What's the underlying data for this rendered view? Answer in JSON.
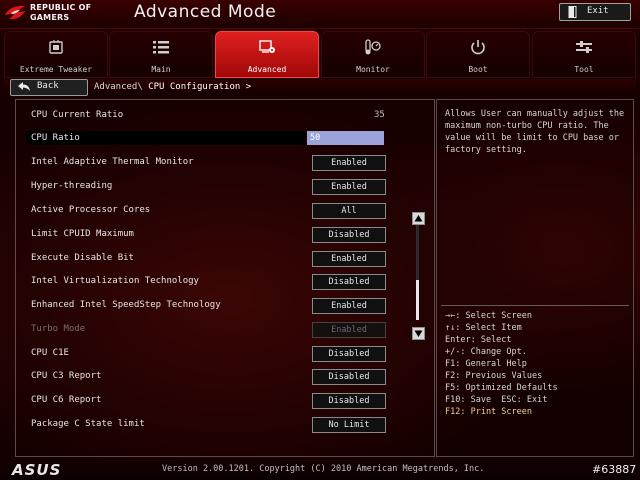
{
  "header": {
    "brand_line1": "REPUBLIC OF",
    "brand_line2": "GAMERS",
    "mode_title": "Advanced Mode",
    "exit_label": "Exit"
  },
  "tabs": [
    {
      "label": "Extreme Tweaker",
      "icon": "extreme-tweaker-icon",
      "active": false
    },
    {
      "label": "Main",
      "icon": "list-icon",
      "active": false
    },
    {
      "label": "Advanced",
      "icon": "advanced-chip-icon",
      "active": true
    },
    {
      "label": "Monitor",
      "icon": "monitor-gauge-icon",
      "active": false
    },
    {
      "label": "Boot",
      "icon": "power-icon",
      "active": false
    },
    {
      "label": "Tool",
      "icon": "tool-icon",
      "active": false
    }
  ],
  "nav": {
    "back_label": "Back",
    "breadcrumb_parent": "Advanced\\",
    "breadcrumb_current": "CPU Configuration >"
  },
  "settings": [
    {
      "label": "CPU Current Ratio",
      "value": "35",
      "kind": "static"
    },
    {
      "label": "CPU Ratio",
      "value": "50",
      "kind": "input"
    },
    {
      "label": "Intel Adaptive Thermal Monitor",
      "value": "Enabled",
      "kind": "select"
    },
    {
      "label": "Hyper-threading",
      "value": "Enabled",
      "kind": "select"
    },
    {
      "label": "Active Processor Cores",
      "value": "All",
      "kind": "select"
    },
    {
      "label": "Limit CPUID Maximum",
      "value": "Disabled",
      "kind": "select"
    },
    {
      "label": "Execute Disable Bit",
      "value": "Enabled",
      "kind": "select"
    },
    {
      "label": "Intel Virtualization Technology",
      "value": "Disabled",
      "kind": "select"
    },
    {
      "label": "Enhanced Intel SpeedStep Technology",
      "value": "Enabled",
      "kind": "select"
    },
    {
      "label": "Turbo Mode",
      "value": "Enabled",
      "kind": "select-disabled"
    },
    {
      "label": "CPU C1E",
      "value": "Disabled",
      "kind": "select"
    },
    {
      "label": "CPU C3 Report",
      "value": "Disabled",
      "kind": "select"
    },
    {
      "label": "CPU C6 Report",
      "value": "Disabled",
      "kind": "select"
    },
    {
      "label": "Package C State limit",
      "value": "No Limit",
      "kind": "select"
    }
  ],
  "help": {
    "description": "Allows User can manually adjust the maximum non-turbo CPU ratio. The value will be limit to CPU base or factory setting.",
    "keys": [
      "→←: Select Screen",
      "↑↓: Select Item",
      "Enter: Select",
      "+/-: Change Opt.",
      "F1: General Help",
      "F2: Previous Values",
      "F5: Optimized Defaults",
      "F10: Save  ESC: Exit",
      "F12: Print Screen"
    ]
  },
  "footer": {
    "brand": "ASUS",
    "version": "Version 2.00.1201. Copyright (C) 2010 American Megatrends, Inc.",
    "watermark": "#63887"
  },
  "colors": {
    "accent": "#d01414",
    "selected_input": "#9ba3d9",
    "hotkey_highlight": "#f0d090"
  }
}
